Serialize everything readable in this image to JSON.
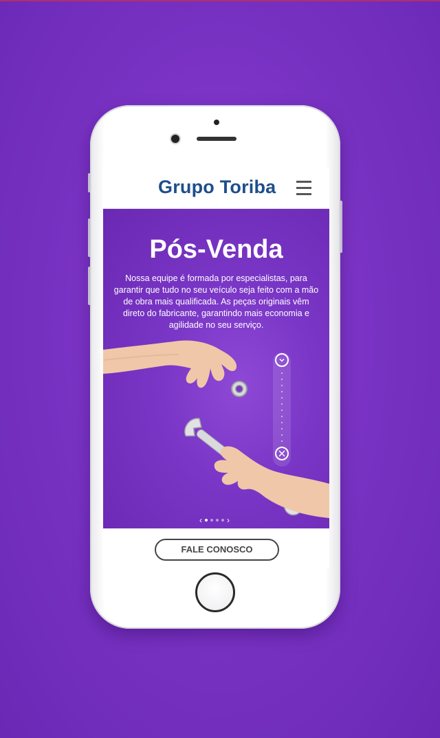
{
  "header": {
    "brand": "Grupo Toriba",
    "menu_icon": "hamburger-menu-icon"
  },
  "hero": {
    "title": "Pós-Venda",
    "text": "Nossa equipe é formada por especialistas, para garantir que tudo no seu veículo seja feito com a mão de obra mais qualificada. As peças originais vêm direto do fabricante, garantindo mais economia e agilidade no seu serviço.",
    "scroll_down_icon": "chevron-down-icon",
    "tools_icon": "wrench-screwdriver-icon",
    "pager": {
      "total": 4,
      "active": 1
    }
  },
  "cta": {
    "label": "FALE CONOSCO"
  },
  "colors": {
    "background": "#7a33c4",
    "hero": "#7a36c6",
    "brand": "#1e4e8c"
  }
}
